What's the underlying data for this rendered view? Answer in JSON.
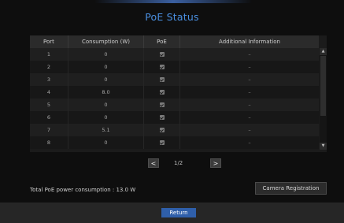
{
  "dialog": {
    "title": "PoE Status"
  },
  "table": {
    "headers": {
      "port": "Port",
      "consumption": "Consumption (W)",
      "poe": "PoE",
      "info": "Additional Information"
    },
    "rows": [
      {
        "port": "1",
        "consumption": "0",
        "poe": true,
        "info": "–"
      },
      {
        "port": "2",
        "consumption": "0",
        "poe": true,
        "info": "–"
      },
      {
        "port": "3",
        "consumption": "0",
        "poe": true,
        "info": "–"
      },
      {
        "port": "4",
        "consumption": "8.0",
        "poe": true,
        "info": "–"
      },
      {
        "port": "5",
        "consumption": "0",
        "poe": true,
        "info": "–"
      },
      {
        "port": "6",
        "consumption": "0",
        "poe": true,
        "info": "–"
      },
      {
        "port": "7",
        "consumption": "5.1",
        "poe": true,
        "info": "–"
      },
      {
        "port": "8",
        "consumption": "0",
        "poe": true,
        "info": "–"
      }
    ]
  },
  "pagination": {
    "prev": "<",
    "next": ">",
    "page_label": "1/2"
  },
  "summary": {
    "total_label": "Total PoE power consumption : 13.0 W"
  },
  "buttons": {
    "camera_registration": "Camera Registration",
    "return": "Return"
  },
  "colors": {
    "accent": "#4a8fe0",
    "return_button": "#2f5faa",
    "background": "#0e0e0e"
  }
}
